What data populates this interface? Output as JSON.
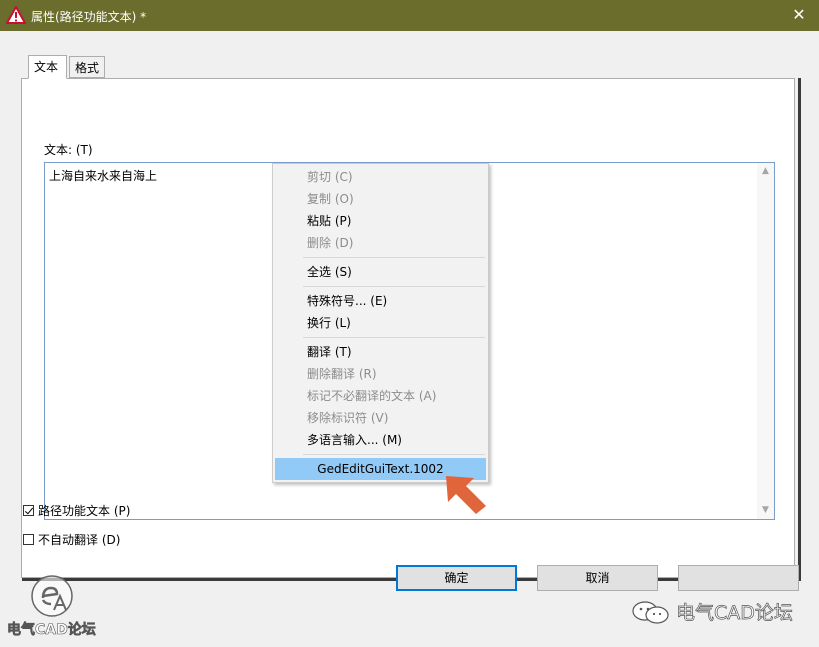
{
  "window": {
    "title": "属性(路径功能文本) *",
    "close_glyph": "✕",
    "warning_icon": "warning-triangle-icon"
  },
  "tabs": [
    {
      "label": "文本",
      "active": true
    },
    {
      "label": "格式",
      "active": false
    }
  ],
  "text_field": {
    "label": "文本: (T)",
    "value": "上海自来水来自海上",
    "scroll_up_glyph": "▲",
    "scroll_down_glyph": "▼"
  },
  "checkboxes": [
    {
      "label": "路径功能文本 (P)",
      "checked": true
    },
    {
      "label": "不自动翻译 (D)",
      "checked": false
    }
  ],
  "buttons": {
    "ok": "确定",
    "cancel": "取消",
    "third": ""
  },
  "context_menu": {
    "items": [
      {
        "label": "剪切 (C)",
        "enabled": false
      },
      {
        "label": "复制 (O)",
        "enabled": false
      },
      {
        "label": "粘贴 (P)",
        "enabled": true
      },
      {
        "label": "删除 (D)",
        "enabled": false
      },
      {
        "label": "全选 (S)",
        "enabled": true
      },
      {
        "label": "特殊符号... (E)",
        "enabled": true
      },
      {
        "label": "换行 (L)",
        "enabled": true
      },
      {
        "label": "翻译 (T)",
        "enabled": true
      },
      {
        "label": "删除翻译 (R)",
        "enabled": false
      },
      {
        "label": "标记不必翻译的文本 (A)",
        "enabled": false
      },
      {
        "label": "移除标识符 (V)",
        "enabled": false
      },
      {
        "label": "多语言输入... (M)",
        "enabled": true
      },
      {
        "label": "GedEditGuiText.1002",
        "enabled": true,
        "highlighted": true
      }
    ]
  },
  "annotation": {
    "arrow_color": "#e0653a",
    "arrow_icon": "pointer-arrow-icon"
  },
  "watermark": {
    "logo_text": "电气CAD论坛",
    "wechat_icon": "wechat-icon",
    "right_text": "电气CAD论坛"
  },
  "colors": {
    "titlebar": "#6b6d2c",
    "focus_border": "#0078d7",
    "menu_highlight": "#91c9f7",
    "disabled_text": "#8c8c8c"
  }
}
